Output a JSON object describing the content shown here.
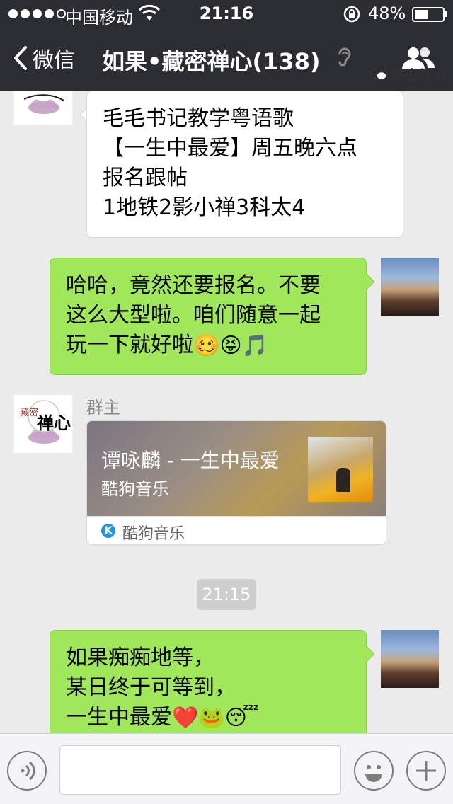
{
  "status_bar": {
    "carrier": "中国移动",
    "time": "21:16",
    "battery_percent_text": "48%",
    "battery_level": 0.48
  },
  "nav": {
    "back_label": "微信",
    "title": "如果•藏密禅心(138)",
    "icons": [
      "back-chevron-icon",
      "earpiece-icon",
      "group-members-icon"
    ]
  },
  "messages": [
    {
      "side": "left",
      "text_lines": [
        "毛毛书记教学粤语歌",
        "【一生中最爱】周五晚六点",
        "报名跟帖",
        "1地铁2影小禅3科太4"
      ]
    },
    {
      "side": "right",
      "text_lines": [
        "哈哈，竟然还要报名。不要",
        "这么大型啦。咱们随意一起",
        "玩一下就好啦"
      ],
      "emoji": [
        "🥴",
        "😝",
        "🎵"
      ]
    },
    {
      "side": "left",
      "sender": "群主",
      "card": {
        "title": "谭咏麟 - 一生中最爱",
        "subtitle": "酷狗音乐",
        "source": "酷狗音乐",
        "source_icon_letter": "K"
      }
    },
    {
      "type": "timestamp",
      "text": "21:15"
    },
    {
      "side": "right",
      "text_lines": [
        "如果痴痴地等，",
        "某日终于可等到，",
        "一生中最爱"
      ],
      "emoji": [
        "❤️",
        "🐸",
        "😴"
      ]
    }
  ],
  "avatar_zen_text": {
    "top": "藏密",
    "main": "禅心"
  },
  "watermark": "藏密禅心",
  "colors": {
    "navbar": "#2b2d32",
    "background": "#ebebeb",
    "bubble_green": "#a0e75a",
    "bubble_white": "#ffffff"
  }
}
